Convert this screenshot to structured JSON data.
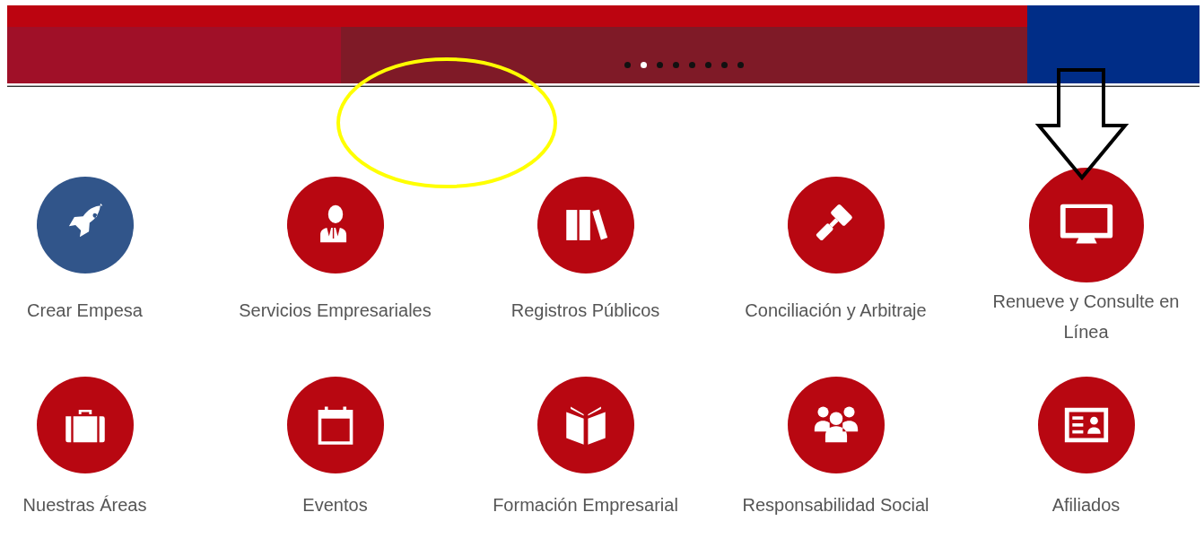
{
  "carousel": {
    "dots": [
      {
        "selected": false
      },
      {
        "selected": true
      },
      {
        "selected": false
      },
      {
        "selected": false
      },
      {
        "selected": false
      },
      {
        "selected": false
      },
      {
        "selected": false
      },
      {
        "selected": false
      }
    ]
  },
  "tiles": [
    {
      "label": "Crear Empesa",
      "color": "#31558a",
      "highlighted": false
    },
    {
      "label": "Servicios Empresariales",
      "color": "#b80711",
      "highlighted": false
    },
    {
      "label": "Registros Públicos",
      "color": "#b80711",
      "highlighted": false
    },
    {
      "label": "Conciliación y Arbitraje",
      "color": "#b80711",
      "highlighted": false
    },
    {
      "label": "Renueve y Consulte en Línea",
      "color": "#b80711",
      "highlighted": true
    },
    {
      "label": "Nuestras Áreas",
      "color": "#b80711",
      "highlighted": false
    },
    {
      "label": "Eventos",
      "color": "#b80711",
      "highlighted": false
    },
    {
      "label": "Formación Empresarial",
      "color": "#b80711",
      "highlighted": false
    },
    {
      "label": "Responsabilidad Social",
      "color": "#b80711",
      "highlighted": false
    },
    {
      "label": "Afiliados",
      "color": "#b80711",
      "highlighted": false
    }
  ]
}
